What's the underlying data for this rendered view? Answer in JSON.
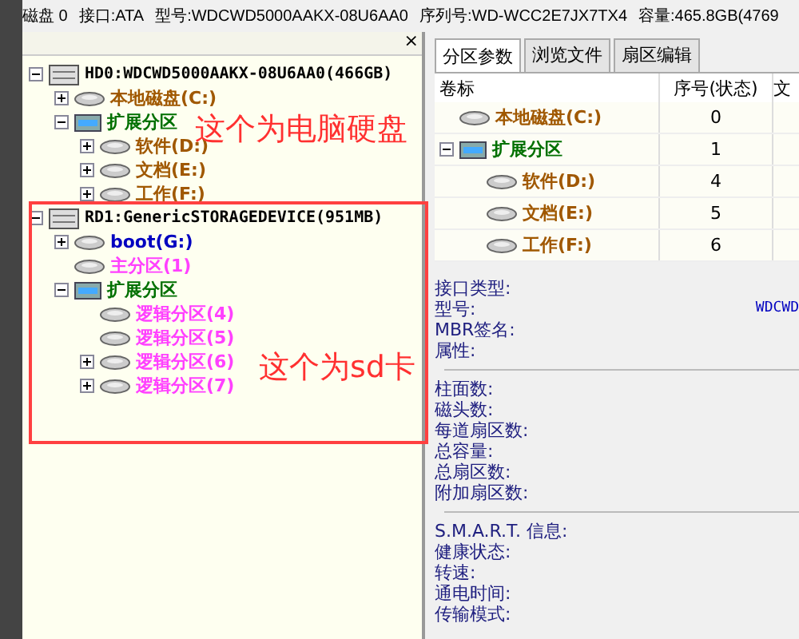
{
  "info_bar": [
    "磁盘 0",
    "接口:ATA",
    "型号:WDCWD5000AAKX-08U6AA0",
    "序列号:WD-WCC2E7JX7TX4",
    "容量:465.8GB(4769"
  ],
  "tree": [
    {
      "label": "HD0:WDCWD5000AAKX-08U6AA0(466GB)",
      "kind": "disk",
      "color": "#000000",
      "expanded": true,
      "children": [
        {
          "label": "本地磁盘(C:)",
          "kind": "partition",
          "color": "#a05800",
          "expanded": false
        },
        {
          "label": "扩展分区",
          "kind": "extended",
          "color": "#007000",
          "expanded": true,
          "children": [
            {
              "label": "软件(D:)",
              "kind": "partition",
              "color": "#a05800",
              "expanded": false
            },
            {
              "label": "文档(E:)",
              "kind": "partition",
              "color": "#a05800",
              "expanded": false
            },
            {
              "label": "工作(F:)",
              "kind": "partition",
              "color": "#a05800",
              "expanded": false
            }
          ]
        }
      ]
    },
    {
      "label": "RD1:GenericSTORAGEDEVICE(951MB)",
      "kind": "disk",
      "color": "#000000",
      "expanded": true,
      "children": [
        {
          "label": "boot(G:)",
          "kind": "partition",
          "color": "#0000c0",
          "expanded": false
        },
        {
          "label": "主分区(1)",
          "kind": "partition",
          "color": "#ff40ff"
        },
        {
          "label": "扩展分区",
          "kind": "extended",
          "color": "#007000",
          "expanded": true,
          "children": [
            {
              "label": "逻辑分区(4)",
              "kind": "partition",
              "color": "#ff40ff"
            },
            {
              "label": "逻辑分区(5)",
              "kind": "partition",
              "color": "#ff40ff"
            },
            {
              "label": "逻辑分区(6)",
              "kind": "partition",
              "color": "#ff40ff",
              "expanded": false
            },
            {
              "label": "逻辑分区(7)",
              "kind": "partition",
              "color": "#ff40ff",
              "expanded": false
            }
          ]
        }
      ]
    }
  ],
  "pane_close": "×",
  "annotations": [
    "这个为电脑硬盘",
    "这个为sd卡"
  ],
  "tabs": [
    {
      "label": "分区参数",
      "selected": true
    },
    {
      "label": "浏览文件",
      "selected": false
    },
    {
      "label": "扇区编辑",
      "selected": false
    }
  ],
  "table": {
    "columns": [
      "卷标",
      "序号(状态)",
      "文"
    ],
    "rows": [
      {
        "label": "本地磁盘(C:)",
        "kind": "partition",
        "color": "#a05800",
        "index": "0"
      },
      {
        "label": "扩展分区",
        "kind": "extended",
        "color": "#007000",
        "index": "1",
        "expanded": true,
        "children": [
          {
            "label": "软件(D:)",
            "kind": "partition",
            "color": "#a05800",
            "index": "4"
          },
          {
            "label": "文档(E:)",
            "kind": "partition",
            "color": "#a05800",
            "index": "5"
          },
          {
            "label": "工作(F:)",
            "kind": "partition",
            "color": "#a05800",
            "index": "6"
          }
        ]
      }
    ]
  },
  "details": [
    [
      {
        "label": "接口类型:"
      },
      {
        "label": "型号:",
        "value": "WDCWD"
      },
      {
        "label": "MBR签名:"
      },
      {
        "label": "属性:"
      }
    ],
    [
      {
        "label": "柱面数:"
      },
      {
        "label": "磁头数:"
      },
      {
        "label": "每道扇区数:"
      },
      {
        "label": "总容量:"
      },
      {
        "label": "总扇区数:"
      },
      {
        "label": "附加扇区数:"
      }
    ],
    [
      {
        "label": "S.M.A.R.T. 信息:"
      },
      {
        "label": "健康状态:"
      },
      {
        "label": "转速:"
      },
      {
        "label": "通电时间:"
      },
      {
        "label": "传输模式:"
      }
    ]
  ]
}
